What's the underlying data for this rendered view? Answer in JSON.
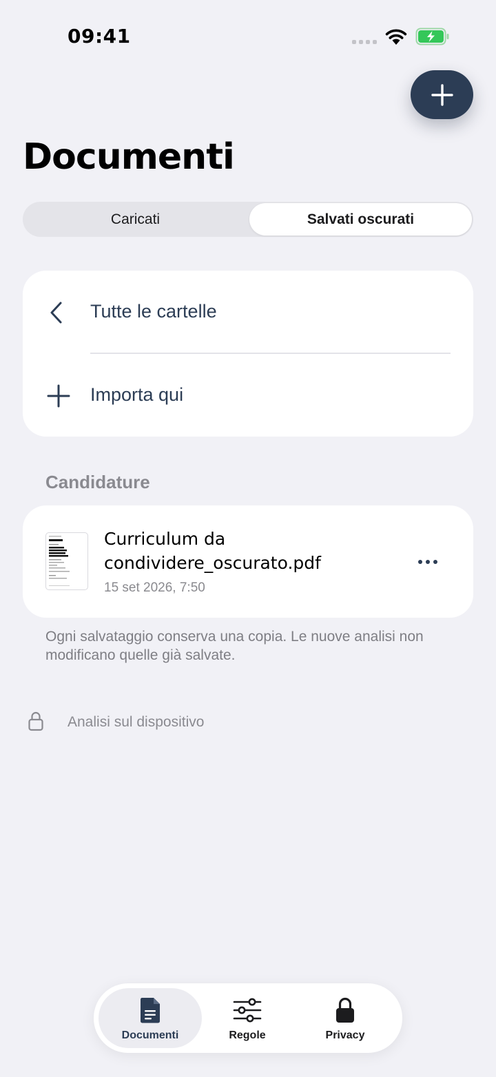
{
  "status_bar": {
    "time": "09:41"
  },
  "header": {
    "title": "Documenti",
    "add_icon": "plus-icon"
  },
  "segments": {
    "left_label": "Caricati",
    "right_label": "Salvati oscurati",
    "selected": "Salvati oscurati"
  },
  "folder_actions": {
    "back_label": "Tutte le cartelle",
    "back_icon": "chevron-left-icon",
    "import_label": "Importa qui",
    "import_icon": "plus-icon"
  },
  "folder": {
    "name": "Candidature",
    "documents": [
      {
        "name": "Curriculum da condividere_oscurato.pdf",
        "date": "15 set 2026, 7:50",
        "menu_icon": "ellipsis-icon"
      }
    ]
  },
  "footnote": "Ogni salvataggio conserva una copia. Le nuove analisi non modificano quelle già salvate.",
  "device_notice": {
    "label": "Analisi sul dispositivo",
    "icon": "lock-outline-icon"
  },
  "tab_bar": {
    "tabs": [
      {
        "label": "Documenti",
        "icon": "document-icon",
        "active": true
      },
      {
        "label": "Regole",
        "icon": "sliders-icon",
        "active": false
      },
      {
        "label": "Privacy",
        "icon": "lock-icon",
        "active": false
      }
    ]
  },
  "colors": {
    "accent": "#2c3d55",
    "background": "#f1f1f6",
    "card": "#ffffff",
    "battery": "#34c759"
  }
}
